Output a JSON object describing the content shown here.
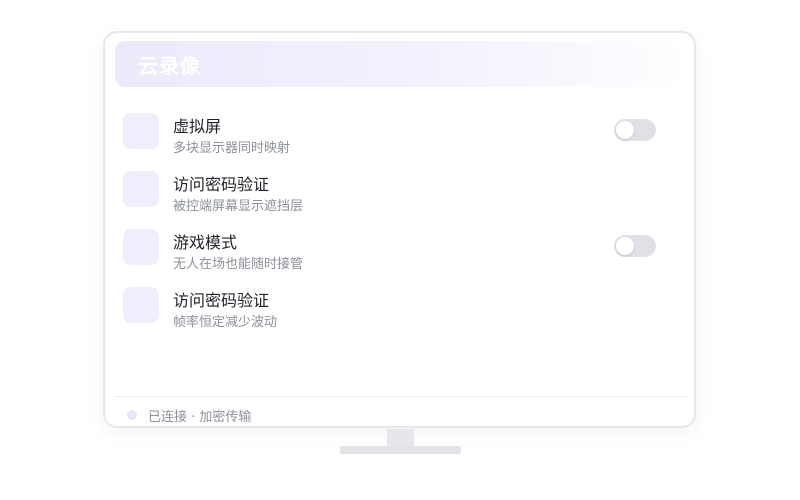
{
  "window": {
    "title": "云录像"
  },
  "settings": [
    {
      "title": "虚拟屏",
      "description": "多块显示器同时映射",
      "has_toggle": true,
      "toggle_on": false
    },
    {
      "title": "访问密码验证",
      "description": "被控端屏幕显示遮挡层",
      "has_toggle": false
    },
    {
      "title": "游戏模式",
      "description": "无人在场也能随时接管",
      "has_toggle": true,
      "toggle_on": false
    },
    {
      "title": "访问密码验证",
      "description": "帧率恒定减少波动",
      "has_toggle": false
    }
  ],
  "footer": {
    "status": "已连接 · 加密传输"
  },
  "colors": {
    "accent_light": "#f0eefc",
    "toggle_off": "#dfe1e6",
    "text_primary": "#1f2228",
    "text_secondary": "#8c9099"
  }
}
